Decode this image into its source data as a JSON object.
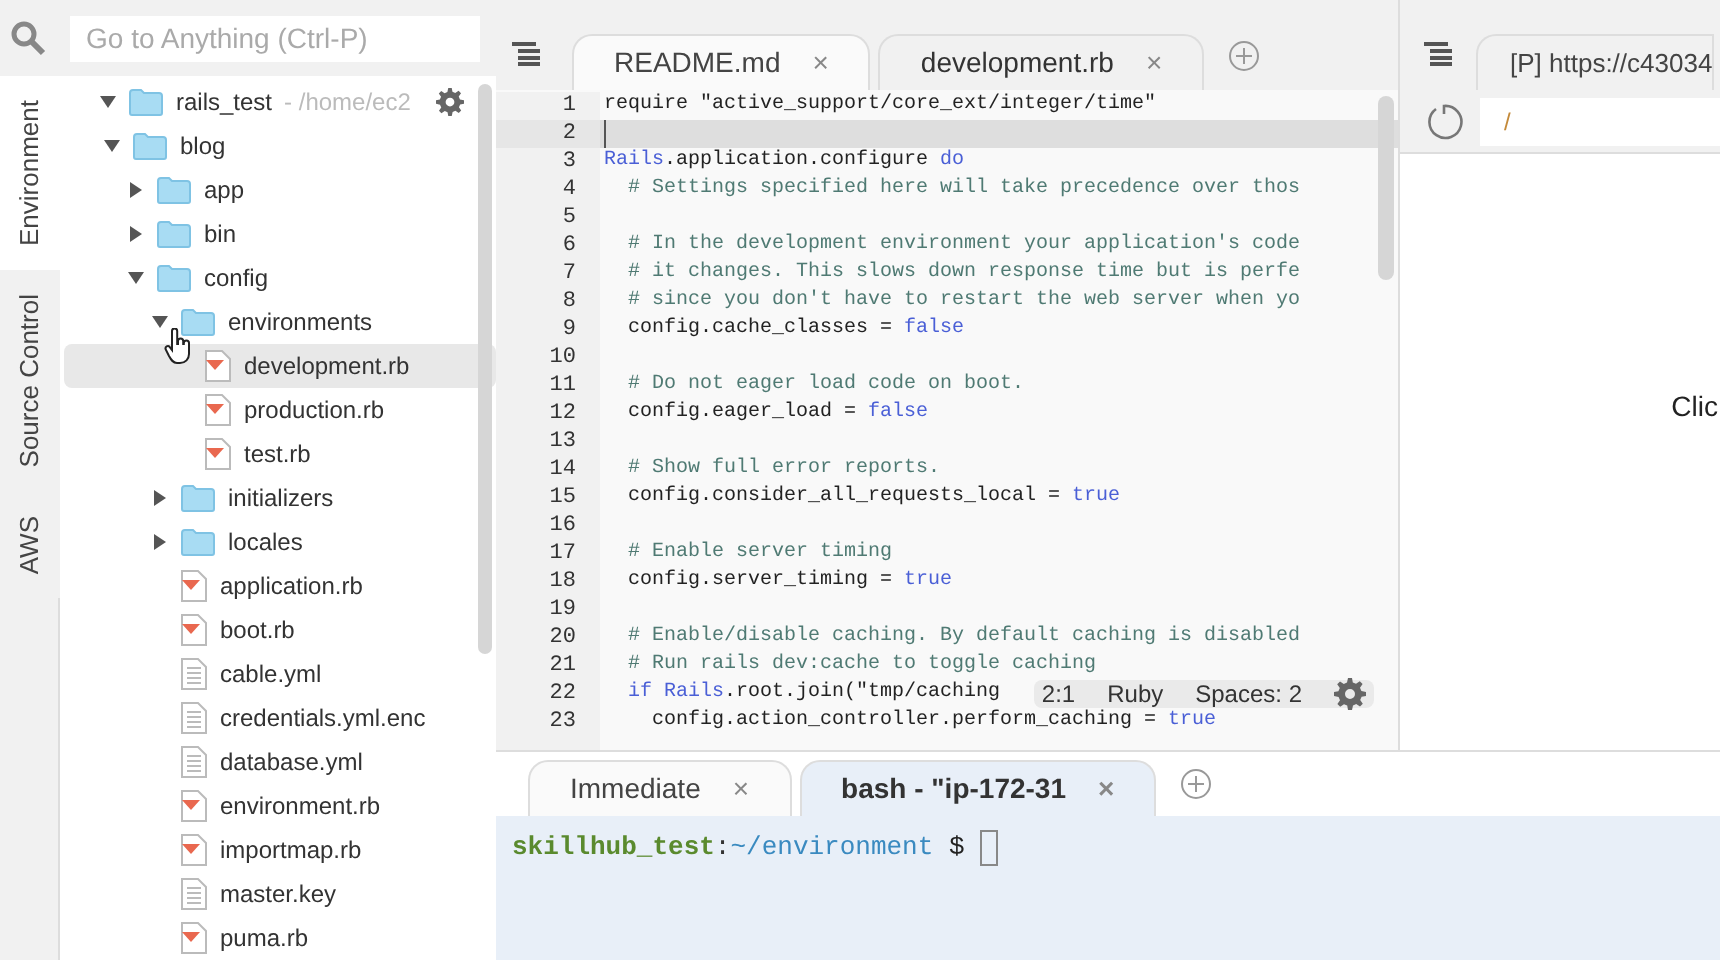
{
  "side_tabs": [
    {
      "label": "Environment",
      "selected": true
    },
    {
      "label": "Source Control",
      "selected": false
    },
    {
      "label": "AWS",
      "selected": false
    }
  ],
  "search": {
    "placeholder": "Go to Anything (Ctrl-P)"
  },
  "tree": {
    "root": {
      "name": "rails_test",
      "path": "- /home/ec2",
      "expanded": true,
      "children": [
        {
          "name": "blog",
          "kind": "folder",
          "expanded": true,
          "selected": false,
          "children": [
            {
              "name": "app",
              "kind": "folder",
              "expanded": false,
              "selected": false
            },
            {
              "name": "bin",
              "kind": "folder",
              "expanded": false,
              "selected": false
            },
            {
              "name": "config",
              "kind": "folder",
              "expanded": true,
              "selected": false,
              "children": [
                {
                  "name": "environments",
                  "kind": "folder",
                  "expanded": true,
                  "selected": false,
                  "children": [
                    {
                      "name": "development.rb",
                      "kind": "ruby",
                      "selected": true
                    },
                    {
                      "name": "production.rb",
                      "kind": "ruby",
                      "selected": false
                    },
                    {
                      "name": "test.rb",
                      "kind": "ruby",
                      "selected": false
                    }
                  ]
                },
                {
                  "name": "initializers",
                  "kind": "folder",
                  "expanded": false,
                  "selected": false
                },
                {
                  "name": "locales",
                  "kind": "folder",
                  "expanded": false,
                  "selected": false
                },
                {
                  "name": "application.rb",
                  "kind": "ruby",
                  "selected": false
                },
                {
                  "name": "boot.rb",
                  "kind": "ruby",
                  "selected": false
                },
                {
                  "name": "cable.yml",
                  "kind": "text",
                  "selected": false
                },
                {
                  "name": "credentials.yml.enc",
                  "kind": "text",
                  "selected": false
                },
                {
                  "name": "database.yml",
                  "kind": "text",
                  "selected": false
                },
                {
                  "name": "environment.rb",
                  "kind": "ruby",
                  "selected": false
                },
                {
                  "name": "importmap.rb",
                  "kind": "ruby",
                  "selected": false
                },
                {
                  "name": "master.key",
                  "kind": "text",
                  "selected": false
                },
                {
                  "name": "puma.rb",
                  "kind": "ruby",
                  "selected": false
                }
              ]
            }
          ]
        }
      ]
    }
  },
  "editor": {
    "tabs": [
      {
        "label": "README.md",
        "close": "×",
        "selected": false
      },
      {
        "label": "development.rb",
        "close": "×",
        "selected": true
      }
    ],
    "lines": [
      {
        "number": "1",
        "current": false,
        "segments": [
          {
            "kind": "plain",
            "text": "require \"active_support/core_ext/integer/time\""
          }
        ]
      },
      {
        "number": "2",
        "current": true
      },
      {
        "number": "3",
        "current": false,
        "segments": [
          {
            "kind": "keyword",
            "text": "Rails"
          },
          {
            "kind": "plain",
            "text": ".application.configure "
          },
          {
            "kind": "keyword",
            "text": "do"
          }
        ]
      },
      {
        "number": "4",
        "current": false,
        "segments": [
          {
            "kind": "comment",
            "text": "  # Settings specified here will take precedence over thos"
          }
        ]
      },
      {
        "number": "5",
        "current": false
      },
      {
        "number": "6",
        "current": false,
        "segments": [
          {
            "kind": "comment",
            "text": "  # In the development environment your application's code"
          }
        ]
      },
      {
        "number": "7",
        "current": false,
        "segments": [
          {
            "kind": "comment",
            "text": "  # it changes. This slows down response time but is perfe"
          }
        ]
      },
      {
        "number": "8",
        "current": false,
        "segments": [
          {
            "kind": "comment",
            "text": "  # since you don't have to restart the web server when yo"
          }
        ]
      },
      {
        "number": "9",
        "current": false,
        "segments": [
          {
            "kind": "plain",
            "text": "  config.cache_classes = "
          },
          {
            "kind": "keyword",
            "text": "false"
          }
        ]
      },
      {
        "number": "10",
        "current": false
      },
      {
        "number": "11",
        "current": false,
        "segments": [
          {
            "kind": "comment",
            "text": "  # Do not eager load code on boot."
          }
        ]
      },
      {
        "number": "12",
        "current": false,
        "segments": [
          {
            "kind": "plain",
            "text": "  config.eager_load = "
          },
          {
            "kind": "keyword",
            "text": "false"
          }
        ]
      },
      {
        "number": "13",
        "current": false
      },
      {
        "number": "14",
        "current": false,
        "segments": [
          {
            "kind": "comment",
            "text": "  # Show full error reports."
          }
        ]
      },
      {
        "number": "15",
        "current": false,
        "segments": [
          {
            "kind": "plain",
            "text": "  config.consider_all_requests_local = "
          },
          {
            "kind": "keyword",
            "text": "true"
          }
        ]
      },
      {
        "number": "16",
        "current": false
      },
      {
        "number": "17",
        "current": false,
        "segments": [
          {
            "kind": "comment",
            "text": "  # Enable server timing"
          }
        ]
      },
      {
        "number": "18",
        "current": false,
        "segments": [
          {
            "kind": "plain",
            "text": "  config.server_timing = "
          },
          {
            "kind": "keyword",
            "text": "true"
          }
        ]
      },
      {
        "number": "19",
        "current": false
      },
      {
        "number": "20",
        "current": false,
        "segments": [
          {
            "kind": "comment",
            "text": "  # Enable/disable caching. By default caching is disabled"
          }
        ]
      },
      {
        "number": "21",
        "current": false,
        "segments": [
          {
            "kind": "comment",
            "text": "  # Run rails dev:cache to toggle caching"
          }
        ]
      },
      {
        "number": "22",
        "current": false,
        "segments": [
          {
            "kind": "keyword",
            "text": "  if Rails"
          },
          {
            "kind": "plain",
            "text": ".root.join(\"tmp/caching"
          }
        ]
      },
      {
        "number": "23",
        "current": false,
        "segments": [
          {
            "kind": "plain",
            "text": "    config.action_controller.perform_caching = "
          },
          {
            "kind": "keyword",
            "text": "true"
          }
        ]
      }
    ],
    "status": {
      "position": "2:1",
      "language": "Ruby",
      "indent": "Spaces: 2"
    }
  },
  "preview": {
    "tab": "[P] https://c43034",
    "address": "/",
    "body_text": "Clic"
  },
  "terminal": {
    "tabs": [
      {
        "label": "Immediate",
        "close": "×",
        "selected": false
      },
      {
        "label": "bash - \"ip-172-31",
        "close": "×",
        "selected": true
      }
    ],
    "prompt": {
      "user": "skillhub_test",
      "separator": ":",
      "path": "~/environment",
      "symbol": "$"
    }
  }
}
